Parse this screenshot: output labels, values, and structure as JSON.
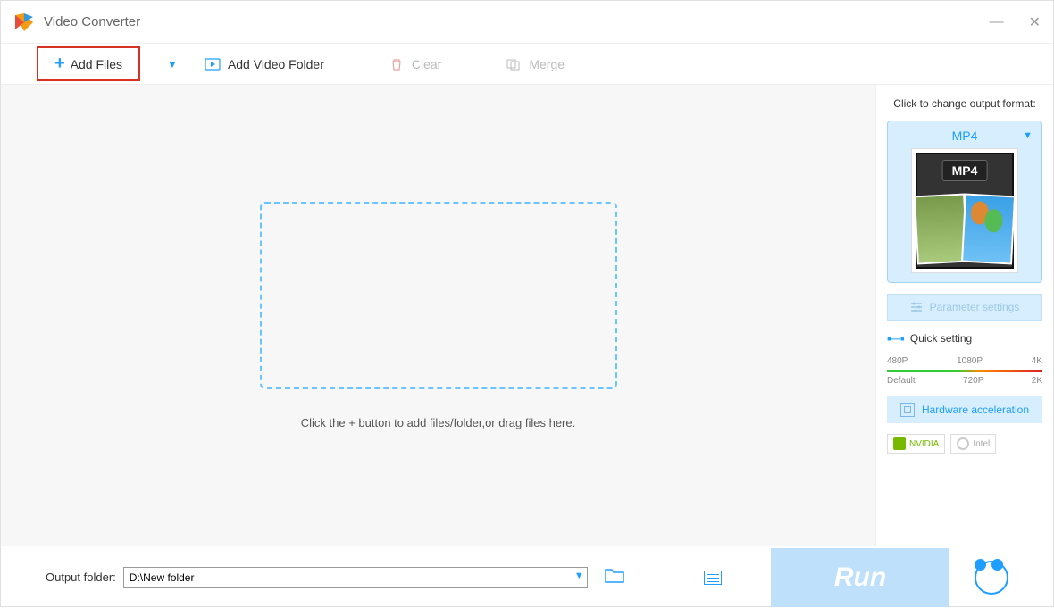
{
  "app": {
    "title": "Video Converter"
  },
  "toolbar": {
    "add_files": "Add Files",
    "add_folder": "Add Video Folder",
    "clear": "Clear",
    "merge": "Merge"
  },
  "dropzone": {
    "hint": "Click the + button to add files/folder,or drag files here."
  },
  "sidebar": {
    "change_format_hint": "Click to change output format:",
    "format_label": "MP4",
    "format_badge": "MP4",
    "parameter_settings": "Parameter settings",
    "quick_setting": "Quick setting",
    "scale_top": [
      "480P",
      "1080P",
      "4K"
    ],
    "scale_bottom": [
      "Default",
      "720P",
      "2K"
    ],
    "hardware_accel": "Hardware acceleration",
    "gpu_nvidia": "NVIDIA",
    "gpu_intel": "Intel"
  },
  "footer": {
    "output_label": "Output folder:",
    "output_path": "D:\\New folder",
    "run": "Run"
  }
}
